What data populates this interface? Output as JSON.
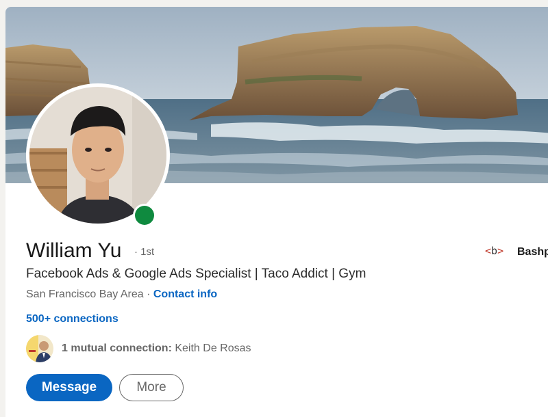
{
  "profile": {
    "name": "William Yu",
    "degree": "· 1st",
    "headline": "Facebook Ads & Google Ads Specialist | Taco Addict | Gym",
    "location": "San Francisco Bay Area",
    "location_separator": " · ",
    "contact_info": "Contact info",
    "connections": "500+ connections",
    "online_status": "online",
    "status_color": "#0f8a3f"
  },
  "mutual": {
    "label": "1 mutual connection:",
    "names": "Keith De Rosas"
  },
  "company": {
    "logo_text_left": "<",
    "logo_text_mid": "b",
    "logo_text_right": ">",
    "name": "Bashp"
  },
  "actions": {
    "message_label": "Message",
    "more_label": "More"
  },
  "colors": {
    "accent": "#0a66c2",
    "online": "#0f8a3f"
  }
}
